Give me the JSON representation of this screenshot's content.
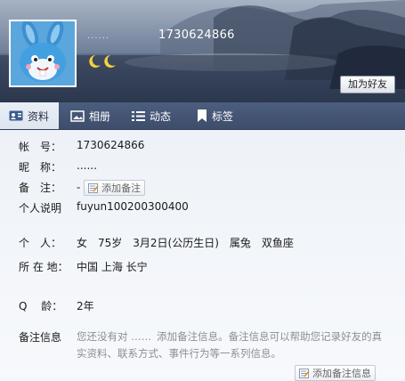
{
  "header": {
    "nickname_dots": "......",
    "uid": "1730624866",
    "add_friend_label": "加为好友",
    "status_icon": "twin-crescent-moon-icon"
  },
  "tabs": [
    {
      "label": "资料",
      "icon": "id-card-icon",
      "active": true
    },
    {
      "label": "相册",
      "icon": "photo-album-icon",
      "active": false
    },
    {
      "label": "动态",
      "icon": "list-icon",
      "active": false
    },
    {
      "label": "标签",
      "icon": "bookmark-icon",
      "active": false
    }
  ],
  "profile": {
    "account": {
      "label": "帐　号：",
      "value": "1730624866"
    },
    "nickname": {
      "label": "昵　称：",
      "value": "......"
    },
    "remark": {
      "label": "备　注：",
      "value": "-",
      "button": "添加备注"
    },
    "signature": {
      "label": "个人说明",
      "value": "fuyun100200300400"
    },
    "personal": {
      "label": "个　人：",
      "value": "女　75岁　3月2日(公历生日)　属兔　双鱼座"
    },
    "location": {
      "label": "所 在 地：",
      "value": "中国 上海 长宁"
    },
    "q_age": {
      "label": "Q　 龄：",
      "value": "2年"
    },
    "remark_info": {
      "label": "备注信息",
      "text_prefix": "您还没有对 ……",
      "text_body": "添加备注信息。备注信息可以帮助您记录好友的真实资料、联系方式、事件行为等一系列信息。",
      "button": "添加备注信息"
    }
  },
  "colors": {
    "tab_bar": "#435473",
    "accent": "#4a8ad6",
    "muted_text": "#8a8f97"
  }
}
